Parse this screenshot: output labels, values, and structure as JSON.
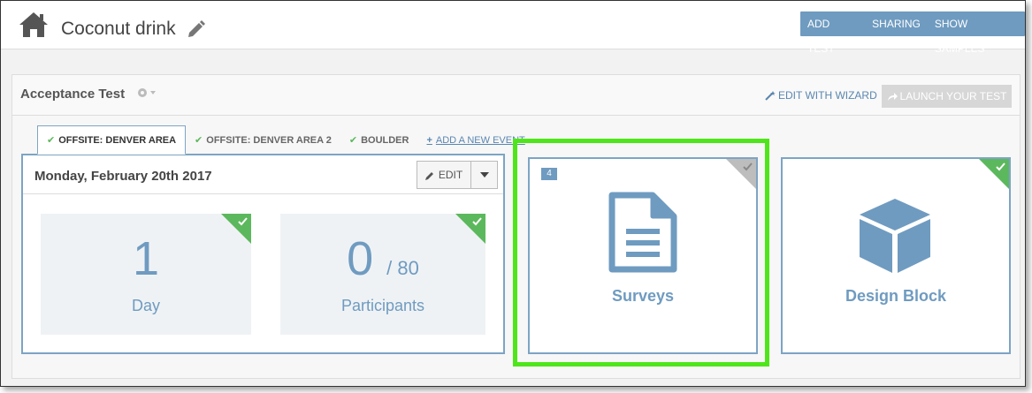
{
  "header": {
    "project_title": "Coconut drink",
    "actions": [
      "ADD TEST",
      "SHARING",
      "SHOW SAMPLES"
    ]
  },
  "test": {
    "name": "Acceptance Test",
    "edit_wizard_label": "EDIT WITH WIZARD",
    "launch_label": "LAUNCH YOUR TEST"
  },
  "tabs": [
    {
      "label": "OFFSITE: DENVER AREA",
      "active": true
    },
    {
      "label": "OFFSITE: DENVER AREA 2",
      "active": false
    },
    {
      "label": "BOULDER",
      "active": false
    }
  ],
  "add_event_label": "ADD A NEW EVENT",
  "event": {
    "date": "Monday, February 20th 2017",
    "edit_label": "EDIT",
    "stats": [
      {
        "value": "1",
        "of": "",
        "label": "Day"
      },
      {
        "value": "0",
        "of": "/ 80",
        "label": "Participants"
      }
    ]
  },
  "tiles": {
    "surveys": {
      "label": "Surveys",
      "badge": "4"
    },
    "design": {
      "label": "Design Block"
    }
  },
  "colors": {
    "accent": "#6f9bc0",
    "check_green": "#5cb85c",
    "highlight": "#4ee61a"
  }
}
